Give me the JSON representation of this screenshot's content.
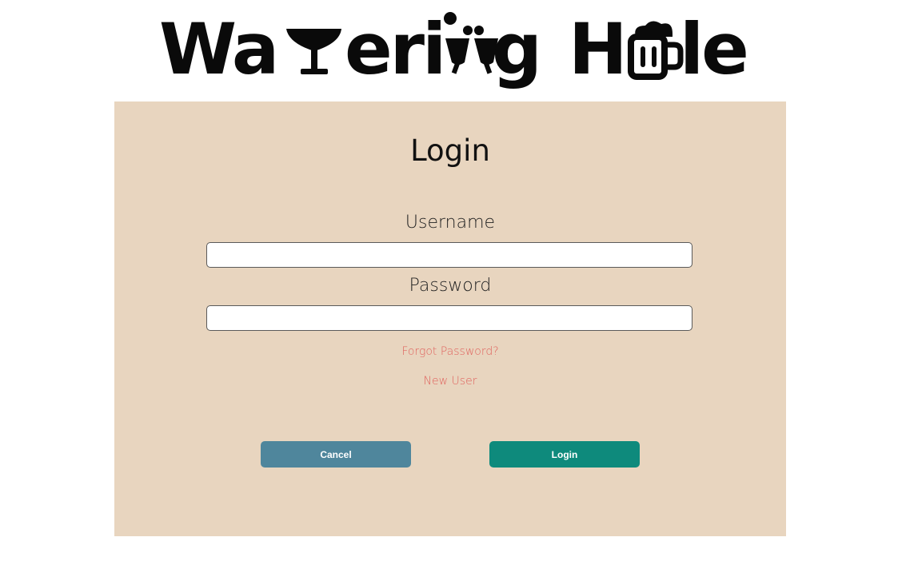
{
  "logo": {
    "text": "Watering Hole",
    "icons": [
      "cocktail-glass-icon",
      "clinking-glasses-icon",
      "beer-mug-icon"
    ]
  },
  "login_form": {
    "title": "Login",
    "username_label": "Username",
    "username_value": "",
    "password_label": "Password",
    "password_value": "",
    "forgot_password_link": "Forgot Password?",
    "new_user_link": "New User",
    "cancel_button": "Cancel",
    "login_button": "Login"
  },
  "colors": {
    "panel_background": "#e8d5bf",
    "link": "#e0635e",
    "cancel_button": "#4f869c",
    "login_button": "#0e8a7c"
  }
}
